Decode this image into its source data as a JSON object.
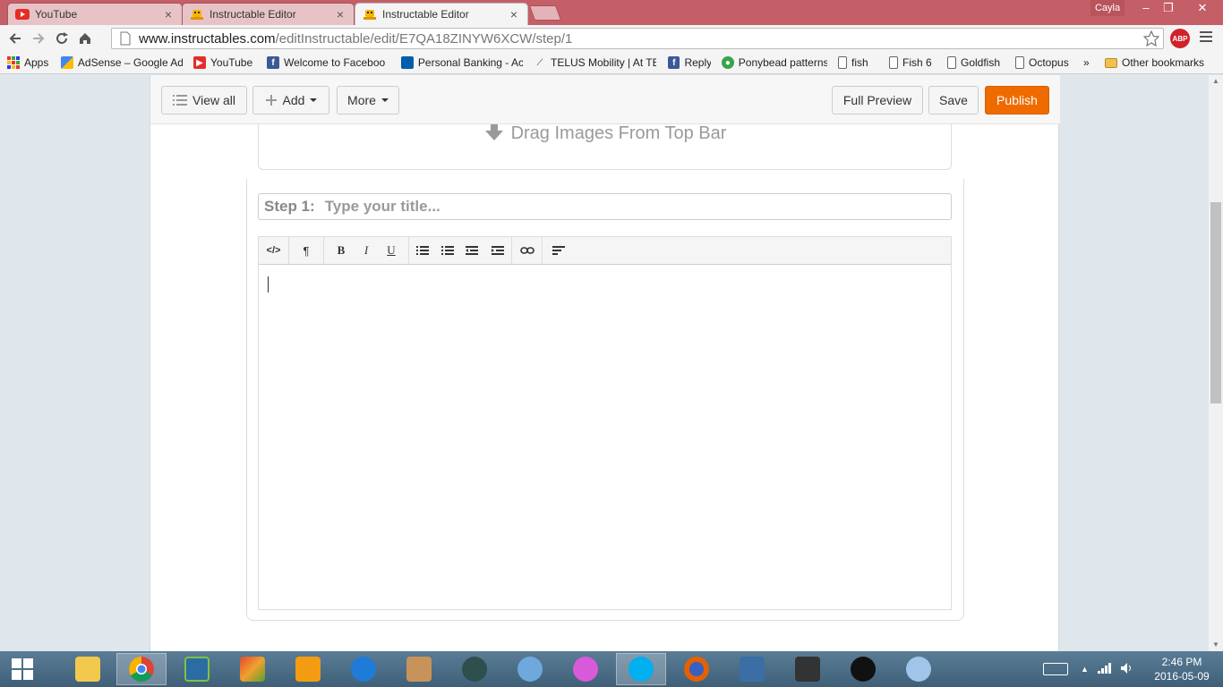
{
  "browser": {
    "tabs": [
      {
        "title": "YouTube",
        "close": "×",
        "icon": "youtube-icon"
      },
      {
        "title": "Instructable Editor",
        "close": "×",
        "icon": "instructables-robot-icon"
      },
      {
        "title": "Instructable Editor",
        "close": "×",
        "icon": "instructables-robot-icon",
        "active": true
      }
    ],
    "profile_name": "Cayla",
    "window_controls": {
      "minimize": "–",
      "restore": "❐",
      "close": "✕"
    },
    "url_host": "www.instructables.com",
    "url_path": "/editInstructable/edit/E7QA18ZINYW6XCW/step/1",
    "abp_label": "ABP"
  },
  "bookmarks": [
    {
      "label": "Apps",
      "icon": "apps-grid-icon"
    },
    {
      "label": "AdSense – Google Ad",
      "icon": "adsense-icon"
    },
    {
      "label": "YouTube",
      "icon": "youtube-icon"
    },
    {
      "label": "Welcome to Faceboo",
      "icon": "facebook-icon"
    },
    {
      "label": "Personal Banking - Ac",
      "icon": "rbc-icon"
    },
    {
      "label": "TELUS Mobility | At TE",
      "icon": "telus-icon"
    },
    {
      "label": "Reply",
      "icon": "facebook-icon"
    },
    {
      "label": "Ponybead patterns",
      "icon": "ponybead-icon"
    },
    {
      "label": "fish",
      "icon": "page-icon"
    },
    {
      "label": "Fish 6",
      "icon": "page-icon"
    },
    {
      "label": "Goldfish",
      "icon": "page-icon"
    },
    {
      "label": "Octopus",
      "icon": "page-icon"
    }
  ],
  "bookmarks_overflow": "»",
  "other_bookmarks": "Other bookmarks",
  "editor": {
    "view_all": "View all",
    "add": "Add",
    "more": "More",
    "full_preview": "Full Preview",
    "save": "Save",
    "publish": "Publish",
    "drag_images": "Drag Images From Top Bar",
    "step_prefix": "Step 1:",
    "title_placeholder": "Type your title...",
    "rte_buttons": [
      "</>",
      "¶",
      "B",
      "I",
      "U"
    ]
  },
  "clock": {
    "time": "2:46 PM",
    "date": "2016-05-09"
  },
  "colors": {
    "publish": "#ef6b00",
    "titlebar": "#c45e67"
  }
}
